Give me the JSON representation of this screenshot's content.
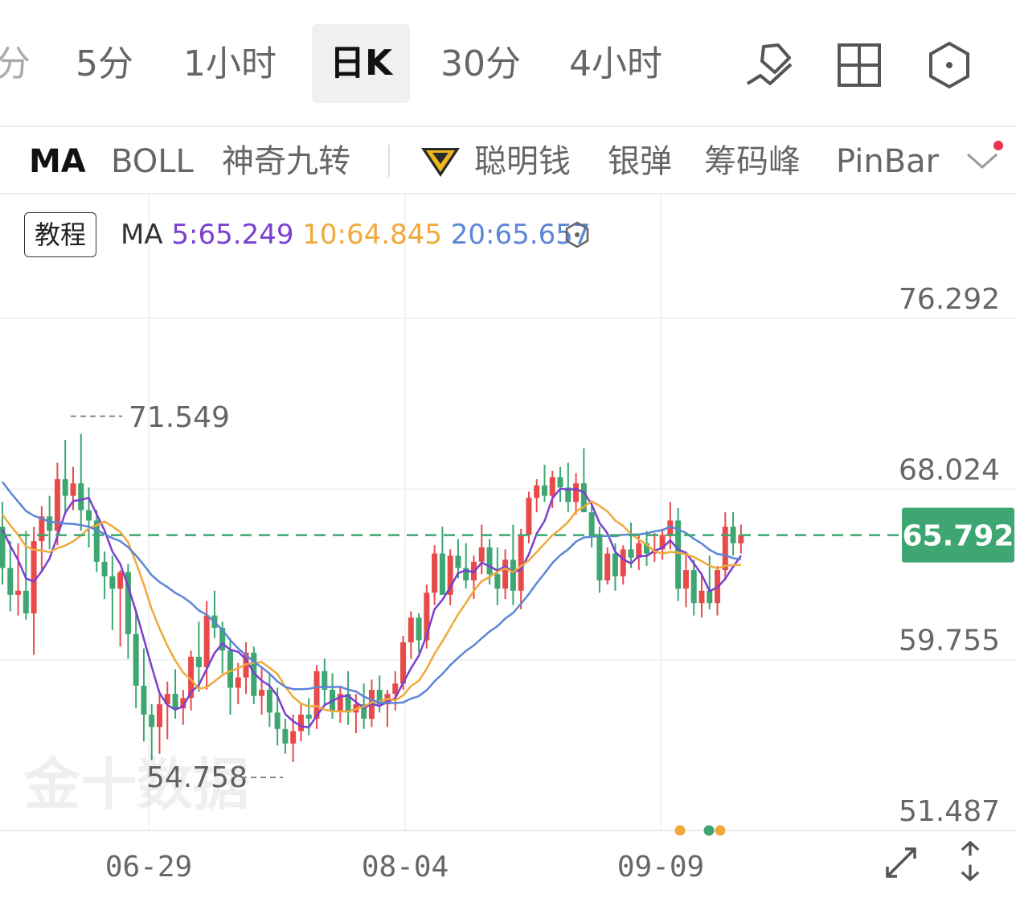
{
  "tabs": [
    {
      "label": "分"
    },
    {
      "label": "5分"
    },
    {
      "label": "1小时"
    },
    {
      "label": "日K",
      "active": true
    },
    {
      "label": "30分"
    },
    {
      "label": "4小时"
    }
  ],
  "toolbar_icons": [
    "draw-pen-icon",
    "grid-layout-icon",
    "hexagon-settings-icon"
  ],
  "indicators": [
    {
      "label": "MA",
      "active": true
    },
    {
      "label": "BOLL"
    },
    {
      "label": "神奇九转"
    },
    {
      "label": "聪明钱",
      "icon": "diamond-crown-icon"
    },
    {
      "label": "银弹"
    },
    {
      "label": "筹码峰"
    },
    {
      "label": "PinBar"
    }
  ],
  "tutorial_label": "教程",
  "ma_legend": {
    "title": "MA",
    "ma5": "5:65.249",
    "ma10": "10:64.845",
    "ma20": "20:65.657"
  },
  "colors": {
    "up": "#e84a4a",
    "down": "#3da671",
    "ma5": "#7b3fd1",
    "ma10": "#f0a93b",
    "ma20": "#5b86d6",
    "current_price_bg": "#3da671",
    "axis_text": "#666666",
    "grid": "#eeeeee"
  },
  "watermark": "金十数据",
  "chart_data": {
    "type": "candlestick",
    "y_axis_labels": [
      "76.292",
      "68.024",
      "59.755",
      "51.487"
    ],
    "ylim": [
      51.487,
      76.292
    ],
    "x_axis_labels": [
      "06-29",
      "08-04",
      "09-09"
    ],
    "current_price": "65.792",
    "max_label": "71.549",
    "min_label": "54.758",
    "candles_ohlc": [
      [
        66.2,
        67.4,
        63.4,
        64.2
      ],
      [
        64.2,
        65.5,
        62.1,
        62.9
      ],
      [
        62.9,
        65.4,
        61.9,
        63.1
      ],
      [
        63.1,
        66.0,
        61.7,
        62.0
      ],
      [
        62.0,
        66.2,
        60.0,
        65.5
      ],
      [
        65.5,
        67.2,
        64.0,
        66.7
      ],
      [
        66.7,
        67.7,
        65.1,
        66.0
      ],
      [
        66.0,
        69.3,
        65.3,
        68.5
      ],
      [
        68.5,
        70.4,
        66.8,
        67.7
      ],
      [
        67.7,
        69.1,
        67.0,
        68.3
      ],
      [
        68.3,
        70.7,
        66.0,
        67.0
      ],
      [
        67.0,
        68.1,
        65.2,
        66.5
      ],
      [
        66.5,
        67.0,
        64.0,
        64.5
      ],
      [
        64.5,
        65.0,
        62.7,
        63.8
      ],
      [
        63.8,
        64.8,
        61.2,
        63.2
      ],
      [
        63.2,
        64.1,
        60.4,
        64.0
      ],
      [
        64.0,
        64.4,
        59.8,
        61.0
      ],
      [
        61.0,
        62.1,
        57.4,
        58.5
      ],
      [
        58.5,
        60.3,
        55.8,
        57.1
      ],
      [
        57.1,
        57.6,
        54.9,
        56.5
      ],
      [
        56.5,
        58.2,
        55.2,
        57.6
      ],
      [
        57.6,
        58.7,
        55.9,
        58.1
      ],
      [
        58.1,
        59.3,
        56.9,
        57.4
      ],
      [
        57.4,
        58.3,
        56.6,
        57.9
      ],
      [
        57.9,
        60.2,
        57.3,
        59.9
      ],
      [
        59.9,
        61.6,
        58.2,
        59.4
      ],
      [
        59.4,
        62.6,
        58.3,
        61.9
      ],
      [
        61.9,
        63.1,
        60.8,
        61.3
      ],
      [
        61.3,
        61.6,
        59.1,
        60.2
      ],
      [
        60.2,
        60.8,
        57.1,
        58.4
      ],
      [
        58.4,
        59.6,
        57.6,
        58.9
      ],
      [
        58.9,
        60.6,
        58.1,
        60.1
      ],
      [
        60.1,
        60.4,
        57.6,
        58.0
      ],
      [
        58.0,
        59.4,
        57.1,
        58.3
      ],
      [
        58.3,
        59.1,
        56.5,
        57.2
      ],
      [
        57.2,
        58.4,
        55.6,
        56.4
      ],
      [
        56.4,
        56.9,
        55.2,
        55.7
      ],
      [
        55.7,
        57.1,
        54.8,
        56.3
      ],
      [
        56.3,
        57.6,
        55.8,
        57.1
      ],
      [
        57.1,
        57.9,
        56.1,
        56.9
      ],
      [
        56.9,
        59.5,
        56.4,
        59.2
      ],
      [
        59.2,
        59.8,
        57.5,
        58.3
      ],
      [
        58.3,
        59.1,
        56.9,
        57.3
      ],
      [
        57.3,
        58.5,
        56.7,
        58.1
      ],
      [
        58.1,
        59.2,
        56.6,
        57.2
      ],
      [
        57.2,
        58.1,
        56.2,
        57.6
      ],
      [
        57.6,
        58.6,
        56.4,
        56.9
      ],
      [
        56.9,
        58.8,
        56.5,
        58.3
      ],
      [
        58.3,
        59.0,
        57.2,
        57.6
      ],
      [
        57.6,
        58.3,
        56.5,
        58.1
      ],
      [
        58.1,
        59.2,
        57.3,
        58.6
      ],
      [
        58.6,
        60.9,
        58.3,
        60.6
      ],
      [
        60.6,
        62.1,
        59.8,
        61.8
      ],
      [
        61.8,
        62.0,
        60.1,
        60.7
      ],
      [
        60.7,
        63.4,
        60.3,
        63.0
      ],
      [
        63.0,
        65.3,
        62.4,
        64.9
      ],
      [
        64.9,
        66.2,
        63.7,
        62.9
      ],
      [
        62.9,
        65.1,
        62.4,
        64.8
      ],
      [
        64.8,
        65.6,
        63.7,
        64.2
      ],
      [
        64.2,
        65.4,
        63.2,
        63.6
      ],
      [
        63.6,
        64.8,
        62.7,
        64.5
      ],
      [
        64.5,
        66.3,
        63.9,
        65.2
      ],
      [
        65.2,
        65.6,
        63.4,
        63.9
      ],
      [
        63.9,
        65.2,
        62.4,
        63.2
      ],
      [
        63.2,
        65.1,
        62.7,
        64.6
      ],
      [
        64.6,
        66.3,
        62.4,
        63.1
      ],
      [
        63.1,
        66.1,
        62.2,
        65.8
      ],
      [
        65.8,
        67.9,
        65.4,
        67.6
      ],
      [
        67.6,
        68.5,
        66.9,
        68.2
      ],
      [
        68.2,
        69.2,
        67.4,
        67.7
      ],
      [
        67.7,
        68.9,
        67.1,
        68.6
      ],
      [
        68.6,
        69.1,
        67.4,
        68.1
      ],
      [
        68.1,
        69.3,
        66.9,
        67.4
      ],
      [
        67.4,
        68.8,
        66.8,
        68.3
      ],
      [
        68.3,
        70.0,
        67.7,
        66.9
      ],
      [
        66.9,
        67.3,
        65.2,
        65.7
      ],
      [
        65.7,
        66.2,
        63.0,
        63.6
      ],
      [
        63.6,
        65.2,
        63.4,
        64.9
      ],
      [
        64.9,
        65.4,
        63.1,
        63.8
      ],
      [
        63.8,
        65.3,
        63.4,
        65.1
      ],
      [
        65.1,
        66.4,
        64.2,
        64.7
      ],
      [
        64.7,
        65.8,
        64.1,
        65.4
      ],
      [
        65.4,
        66.0,
        64.3,
        64.9
      ],
      [
        64.9,
        65.9,
        64.5,
        65.1
      ],
      [
        65.1,
        66.1,
        64.6,
        65.8
      ],
      [
        65.8,
        67.4,
        65.1,
        66.5
      ],
      [
        66.5,
        67.1,
        62.6,
        63.2
      ],
      [
        63.2,
        65.0,
        62.3,
        64.1
      ],
      [
        64.1,
        64.6,
        61.9,
        62.5
      ],
      [
        62.5,
        63.9,
        61.8,
        63.1
      ],
      [
        63.1,
        64.8,
        62.2,
        62.5
      ],
      [
        62.5,
        64.3,
        61.9,
        64.1
      ],
      [
        64.1,
        66.9,
        63.6,
        66.2
      ],
      [
        66.2,
        66.9,
        64.8,
        65.4
      ],
      [
        65.4,
        66.3,
        64.9,
        65.8
      ]
    ]
  }
}
